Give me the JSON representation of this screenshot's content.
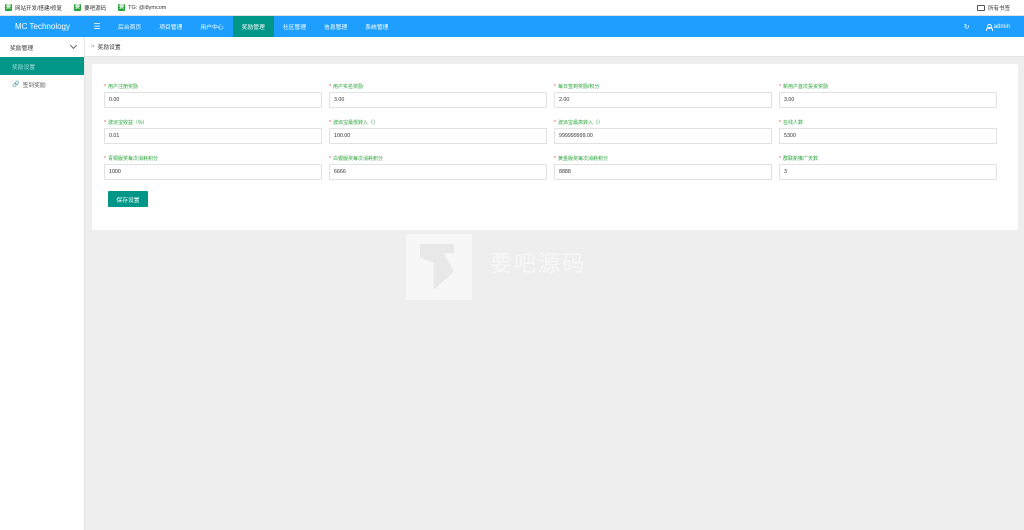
{
  "bookmarks": [
    {
      "icon": "site-dev-icon",
      "label": "网站开发/搭建/修复"
    },
    {
      "icon": "site-icon",
      "label": "要吧源码"
    },
    {
      "icon": "telegram-icon",
      "label": "TG: @i8ymcom"
    }
  ],
  "bookmarks_right": "所有书签",
  "header": {
    "logo": "MC Technology",
    "menu_icon": "☰",
    "nav": [
      "后台首页",
      "项目管理",
      "用户中心",
      "奖励管理",
      "社区管理",
      "信息管理",
      "系统管理"
    ],
    "active_nav": "奖励管理",
    "refresh_icon": "↻",
    "user": "admin"
  },
  "sidebar": {
    "group": "奖励管理",
    "items": [
      {
        "label": "奖励设置",
        "active": true
      },
      {
        "label": "签到奖励",
        "active": false
      }
    ]
  },
  "breadcrumb": "奖励设置",
  "form": {
    "fields": [
      {
        "label": "用户注册奖励",
        "value": "0.00"
      },
      {
        "label": "用户实名奖励",
        "value": "3.00"
      },
      {
        "label": "每日签到奖励/积分",
        "value": "2.00"
      },
      {
        "label": "新用户首次投资奖励",
        "value": "3.00"
      },
      {
        "label": "波派宝收益（%）",
        "value": "0.01"
      },
      {
        "label": "波派宝最低转入（）",
        "value": "100.00"
      },
      {
        "label": "波派宝最高转入（）",
        "value": "999999999.00"
      },
      {
        "label": "在线人数",
        "value": "5300"
      },
      {
        "label": "青铜版奖每次消耗积分",
        "value": "1000"
      },
      {
        "label": "白银版奖每次消耗积分",
        "value": "6666"
      },
      {
        "label": "黄金版奖每次消耗积分",
        "value": "8888"
      },
      {
        "label": "群联新推广天数",
        "value": "3"
      }
    ],
    "save_label": "保存设置"
  },
  "watermark": {
    "text": "要吧源码"
  }
}
